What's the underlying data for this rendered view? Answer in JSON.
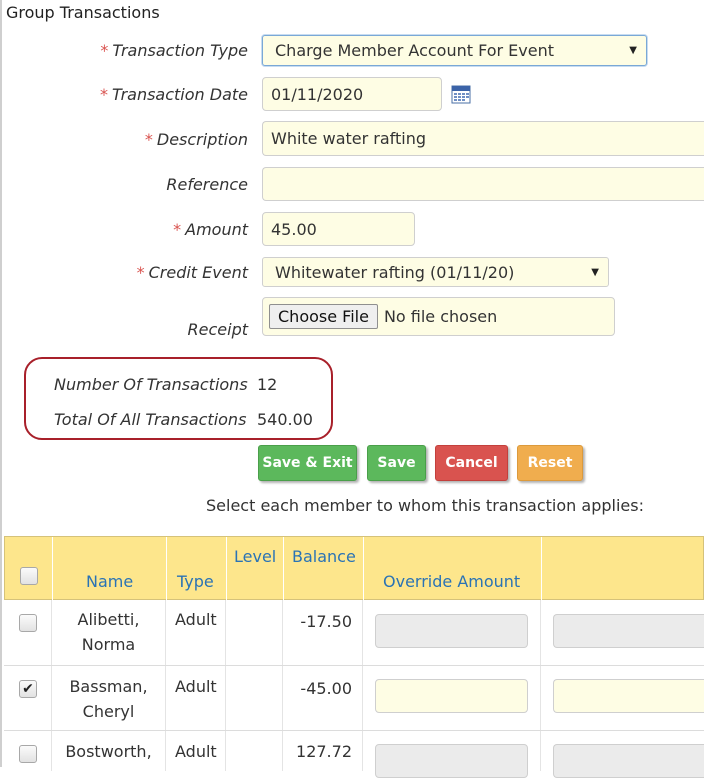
{
  "section_title": "Group Transactions",
  "form": {
    "required_marker": "*",
    "transaction_type": {
      "label": "Transaction Type",
      "value": "Charge Member Account For Event"
    },
    "transaction_date": {
      "label": "Transaction Date",
      "value": "01/11/2020"
    },
    "description": {
      "label": "Description",
      "value": "White water rafting"
    },
    "reference": {
      "label": "Reference",
      "value": ""
    },
    "amount": {
      "label": "Amount",
      "value": "45.00"
    },
    "credit_event": {
      "label": "Credit Event",
      "value": "Whitewater rafting (01/11/20)"
    },
    "receipt": {
      "label": "Receipt",
      "button": "Choose File",
      "status": "No file chosen"
    }
  },
  "summary": {
    "count_label": "Number Of Transactions",
    "count_value": "12",
    "total_label": "Total Of All Transactions",
    "total_value": "540.00"
  },
  "buttons": {
    "save_exit": "Save & Exit",
    "save": "Save",
    "cancel": "Cancel",
    "reset": "Reset"
  },
  "instruction": "Select each member to whom this transaction applies:",
  "table": {
    "headers": {
      "name": "Name",
      "type": "Type",
      "level": "Level",
      "balance": "Balance",
      "override": "Override Amount"
    },
    "rows": [
      {
        "name_line1": "Alibetti,",
        "name_line2": "Norma",
        "type": "Adult",
        "level": "",
        "balance": "-17.50",
        "checked": false
      },
      {
        "name_line1": "Bassman,",
        "name_line2": "Cheryl",
        "type": "Adult",
        "level": "",
        "balance": "-45.00",
        "checked": true
      },
      {
        "name_line1": "Bostworth,",
        "name_line2": "",
        "type": "Adult",
        "level": "",
        "balance": "127.72",
        "checked": false
      }
    ]
  },
  "icons": {
    "calendar": "calendar-icon",
    "dropdown": "triangle-down-icon",
    "check": "checkmark-icon"
  },
  "colors": {
    "required": "#d9534f",
    "input_bg": "#fefde4",
    "header_bg": "#fde68c",
    "header_text": "#2a73b5",
    "highlight": "#a8202a"
  }
}
